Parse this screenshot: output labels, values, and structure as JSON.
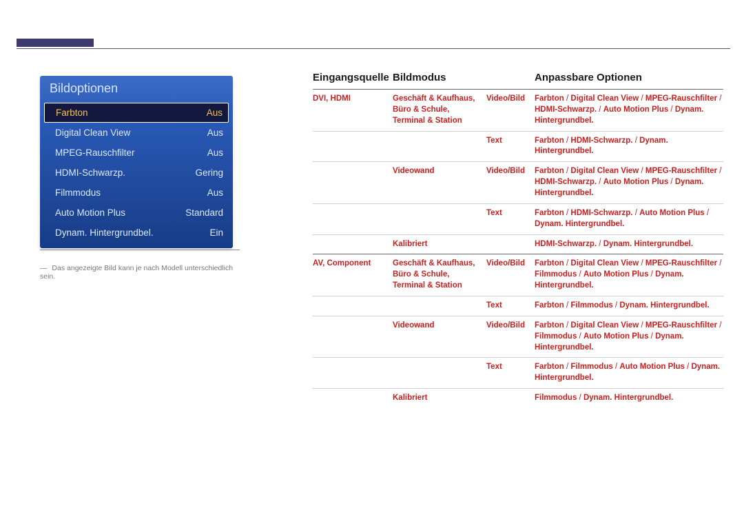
{
  "menu": {
    "title": "Bildoptionen",
    "items": [
      {
        "label": "Farbton",
        "value": "Aus",
        "selected": true
      },
      {
        "label": "Digital Clean View",
        "value": "Aus"
      },
      {
        "label": "MPEG-Rauschfilter",
        "value": "Aus"
      },
      {
        "label": "HDMI-Schwarzp.",
        "value": "Gering"
      },
      {
        "label": "Filmmodus",
        "value": "Aus"
      },
      {
        "label": "Auto Motion Plus",
        "value": "Standard"
      },
      {
        "label": "Dynam. Hintergrundbel.",
        "value": "Ein"
      }
    ]
  },
  "footnote": "Das angezeigte Bild kann je nach Modell unterschiedlich sein.",
  "table": {
    "headers": {
      "c1": "Eingangsquelle",
      "c2": "Bildmodus",
      "c3": "",
      "c4": "Anpassbare Optionen"
    },
    "rows": [
      {
        "top": true,
        "c1": "DVI, HDMI",
        "c2": "Geschäft & Kaufhaus, Büro & Schule, Terminal & Station",
        "c3": "Video/Bild",
        "opts": [
          "Farbton",
          "Digital Clean View",
          "MPEG-Rauschfilter",
          "HDMI-Schwarzp.",
          "Auto Motion Plus",
          "Dynam. Hintergrundbel."
        ]
      },
      {
        "c1": "",
        "c2": "",
        "c3": "Text",
        "opts": [
          "Farbton",
          "HDMI-Schwarzp.",
          "Dynam. Hintergrundbel."
        ]
      },
      {
        "c1": "",
        "c2": "Videowand",
        "c3": "Video/Bild",
        "opts": [
          "Farbton",
          "Digital Clean View",
          "MPEG-Rauschfilter",
          "HDMI-Schwarzp.",
          "Auto Motion Plus",
          "Dynam. Hintergrundbel."
        ]
      },
      {
        "c1": "",
        "c2": "",
        "c3": "Text",
        "opts": [
          "Farbton",
          "HDMI-Schwarzp.",
          "Auto Motion Plus",
          "Dynam. Hintergrundbel."
        ]
      },
      {
        "c1": "",
        "c2": "Kalibriert",
        "c3": "",
        "opts": [
          "HDMI-Schwarzp.",
          "Dynam. Hintergrundbel."
        ]
      },
      {
        "top": true,
        "c1": "AV, Component",
        "c2": "Geschäft & Kaufhaus, Büro & Schule, Terminal & Station",
        "c3": "Video/Bild",
        "opts": [
          "Farbton",
          "Digital Clean View",
          "MPEG-Rauschfilter",
          "Filmmodus",
          "Auto Motion Plus",
          "Dynam. Hintergrundbel."
        ]
      },
      {
        "c1": "",
        "c2": "",
        "c3": "Text",
        "opts": [
          "Farbton",
          "Filmmodus",
          "Dynam. Hintergrundbel."
        ]
      },
      {
        "c1": "",
        "c2": "Videowand",
        "c3": "Video/Bild",
        "opts": [
          "Farbton",
          "Digital Clean View",
          "MPEG-Rauschfilter",
          "Filmmodus",
          "Auto Motion Plus",
          "Dynam. Hintergrundbel."
        ]
      },
      {
        "c1": "",
        "c2": "",
        "c3": "Text",
        "opts": [
          "Farbton",
          "Filmmodus",
          "Auto Motion Plus",
          "Dynam. Hintergrundbel."
        ]
      },
      {
        "c1": "",
        "c2": "Kalibriert",
        "c3": "",
        "opts": [
          "Filmmodus",
          "Dynam. Hintergrundbel."
        ]
      }
    ]
  }
}
